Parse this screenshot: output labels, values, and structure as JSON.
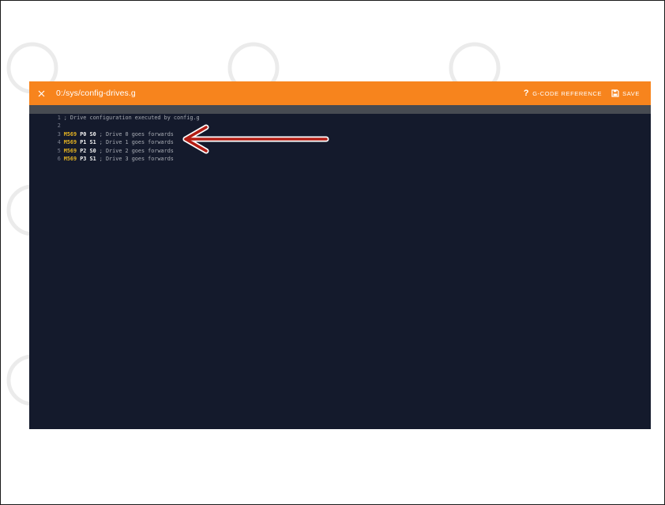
{
  "toolbar": {
    "close_icon": "close-icon",
    "file_path": "0:/sys/config-drives.g",
    "gcode_reference_label": "G-CODE REFERENCE",
    "save_label": "SAVE",
    "accent_color": "#f7841d"
  },
  "editor": {
    "background_color": "#141a2c",
    "lines": [
      {
        "number": "1",
        "text": "; Drive configuration executed by config.g"
      },
      {
        "number": "2",
        "text": ""
      },
      {
        "number": "3",
        "cmd": "M569",
        "p": "P0",
        "s": "S0",
        "comment": "; Drive 0 goes forwards"
      },
      {
        "number": "4",
        "cmd": "M569",
        "p": "P1",
        "s": "S1",
        "comment": "; Drive 1 goes forwards"
      },
      {
        "number": "5",
        "cmd": "M569",
        "p": "P2",
        "s": "S0",
        "comment": "; Drive 2 goes forwards"
      },
      {
        "number": "6",
        "cmd": "M569",
        "p": "P3",
        "s": "S1",
        "comment": "; Drive 3 goes forwards"
      }
    ]
  },
  "annotation": {
    "arrow_color": "#b31d14"
  }
}
